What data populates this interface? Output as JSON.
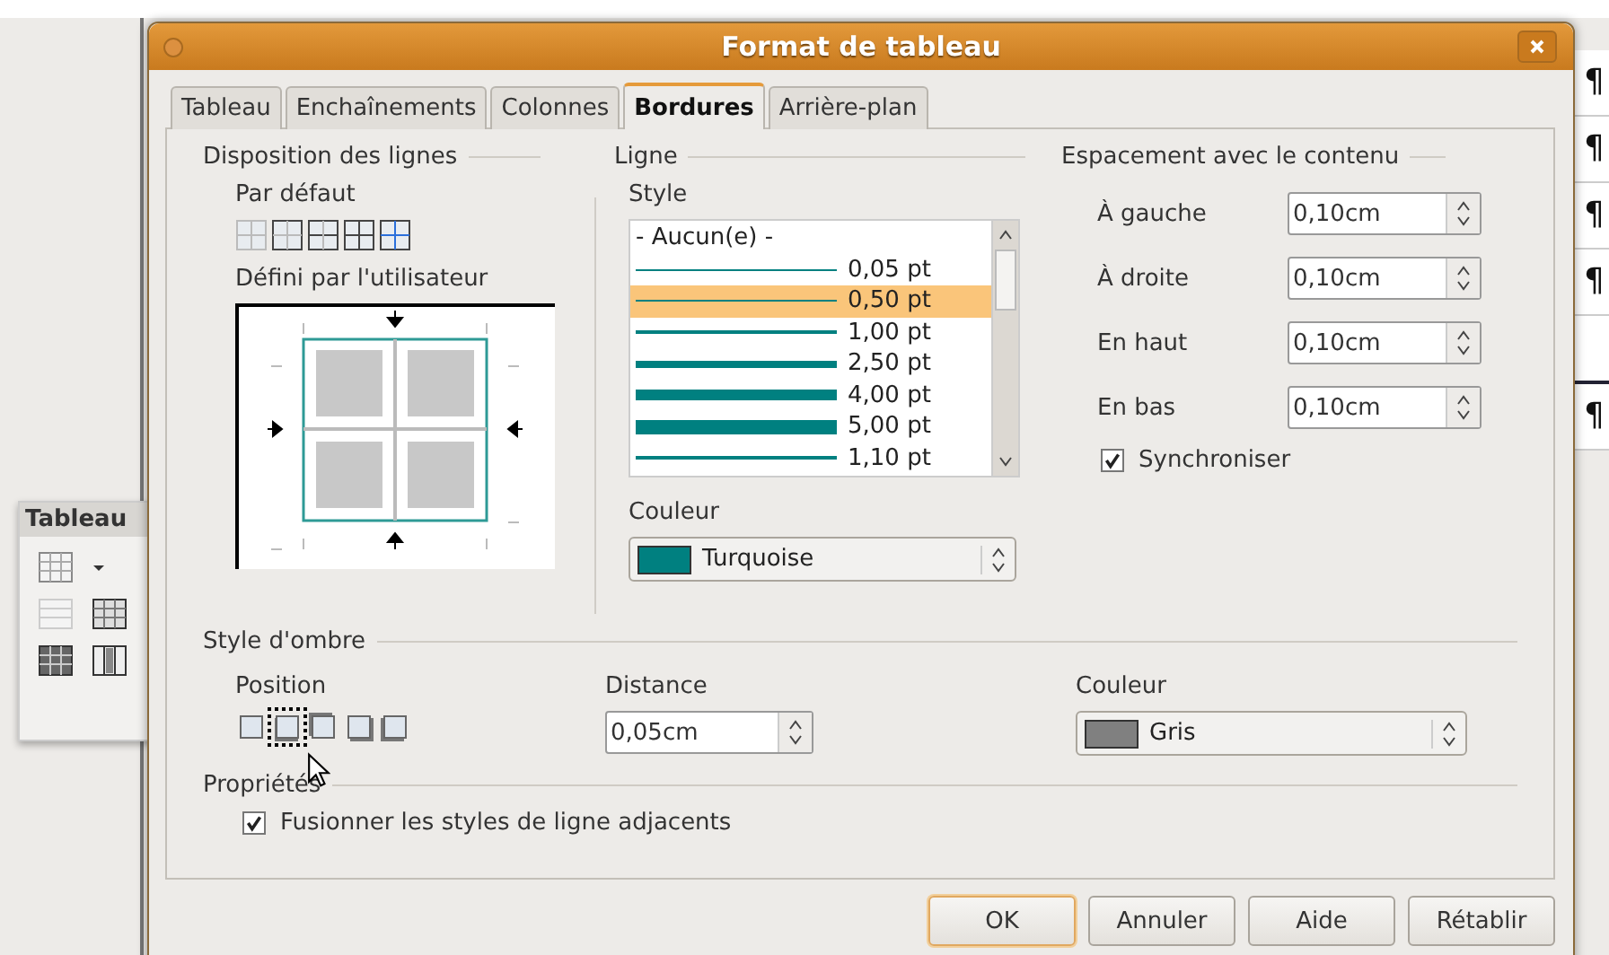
{
  "window": {
    "title": "Format de tableau"
  },
  "tabs": [
    {
      "label": "Tableau",
      "selected": false
    },
    {
      "label": "Enchaînements",
      "selected": false
    },
    {
      "label": "Colonnes",
      "selected": false
    },
    {
      "label": "Bordures",
      "selected": true
    },
    {
      "label": "Arrière-plan",
      "selected": false
    }
  ],
  "line_arrangement": {
    "title": "Disposition des lignes",
    "default_label": "Par défaut",
    "user_defined_label": "Défini par l'utilisateur"
  },
  "line": {
    "title": "Ligne",
    "style_label": "Style",
    "styles": [
      {
        "label": "- Aucun(e) -",
        "kind": "none",
        "selected": false
      },
      {
        "label": "0,05 pt",
        "kind": "hairline",
        "selected": false
      },
      {
        "label": "0,50 pt",
        "kind": "hairline",
        "selected": true
      },
      {
        "label": "1,00 pt",
        "kind": "thin",
        "selected": false
      },
      {
        "label": "2,50 pt",
        "kind": "medium",
        "selected": false
      },
      {
        "label": "4,00 pt",
        "kind": "thick",
        "selected": false
      },
      {
        "label": "5,00 pt",
        "kind": "heavy",
        "selected": false
      },
      {
        "label": "1,10 pt",
        "kind": "thin",
        "selected": false
      }
    ],
    "color_label": "Couleur",
    "color": {
      "label": "Turquoise",
      "color": "#008080"
    }
  },
  "spacing": {
    "title": "Espacement avec le contenu",
    "fields": [
      {
        "label": "À gauche",
        "value": "0,10cm"
      },
      {
        "label": "À droite",
        "value": "0,10cm"
      },
      {
        "label": "En haut",
        "value": "0,10cm"
      },
      {
        "label": "En bas",
        "value": "0,10cm"
      }
    ],
    "synchronize": {
      "label": "Synchroniser",
      "checked": true
    }
  },
  "shadow": {
    "title": "Style d'ombre",
    "position_label": "Position",
    "positions": [
      {
        "selected": false
      },
      {
        "selected": true
      },
      {
        "selected": false
      },
      {
        "selected": false
      },
      {
        "selected": false
      }
    ],
    "distance_label": "Distance",
    "distance_value": "0,05cm",
    "color_label": "Couleur",
    "color": {
      "label": "Gris",
      "color": "#808080"
    }
  },
  "properties": {
    "title": "Propriétés",
    "merge": {
      "label": "Fusionner les styles de ligne adjacents",
      "checked": true
    }
  },
  "buttons": [
    {
      "label": "OK",
      "default": true
    },
    {
      "label": "Annuler",
      "default": false
    },
    {
      "label": "Aide",
      "default": false
    },
    {
      "label": "Rétablir",
      "default": false
    }
  ],
  "toolbar": {
    "title": "Tableau"
  },
  "document": {
    "marks": [
      "¶",
      "¶",
      "¶",
      "¶",
      "¶"
    ]
  }
}
